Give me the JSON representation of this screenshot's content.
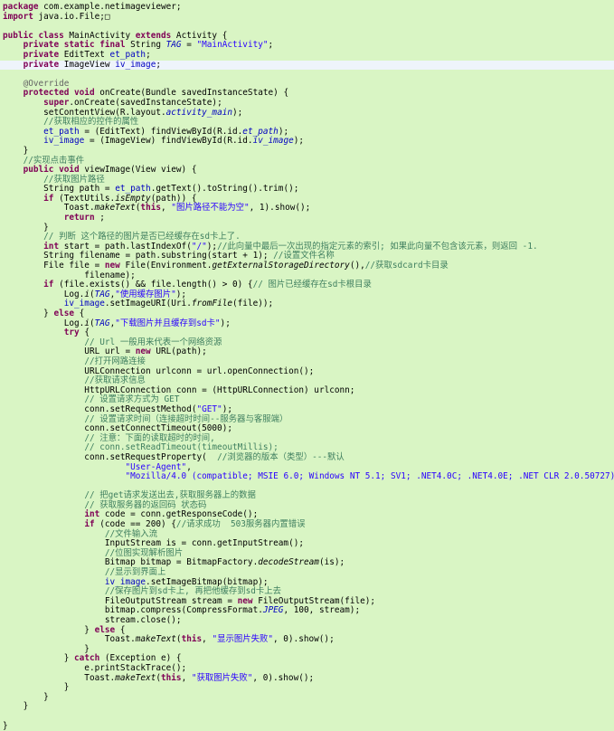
{
  "editor": {
    "lines": [
      [
        [
          "k",
          "package"
        ],
        [
          "p",
          " com.example.netimageviewer;"
        ]
      ],
      [
        [
          "k",
          "import"
        ],
        [
          "p",
          " java.io.File;□"
        ]
      ],
      [
        [
          "p",
          ""
        ]
      ],
      [
        [
          "k",
          "public class"
        ],
        [
          "p",
          " MainActivity "
        ],
        [
          "k",
          "extends"
        ],
        [
          "p",
          " Activity {"
        ]
      ],
      [
        [
          "p",
          "    "
        ],
        [
          "k",
          "private static final"
        ],
        [
          "p",
          " String "
        ],
        [
          "fi",
          "TAG"
        ],
        [
          "p",
          " = "
        ],
        [
          "s",
          "\"MainActivity\""
        ],
        [
          "p",
          ";"
        ]
      ],
      [
        [
          "p",
          "    "
        ],
        [
          "k",
          "private"
        ],
        [
          "p",
          " EditText "
        ],
        [
          "f",
          "et_path"
        ],
        [
          "p",
          ";"
        ]
      ],
      [
        [
          "p",
          "    "
        ],
        [
          "k",
          "private"
        ],
        [
          "p",
          " ImageView "
        ],
        [
          "f",
          "iv_image"
        ],
        [
          "p",
          ";"
        ]
      ],
      [
        [
          "p",
          ""
        ]
      ],
      [
        [
          "p",
          "    "
        ],
        [
          "a",
          "@Override"
        ]
      ],
      [
        [
          "p",
          "    "
        ],
        [
          "k",
          "protected void"
        ],
        [
          "p",
          " onCreate(Bundle savedInstanceState) {"
        ]
      ],
      [
        [
          "p",
          "        "
        ],
        [
          "k",
          "super"
        ],
        [
          "p",
          ".onCreate(savedInstanceState);"
        ]
      ],
      [
        [
          "p",
          "        setContentView(R.layout."
        ],
        [
          "fi",
          "activity_main"
        ],
        [
          "p",
          ");"
        ]
      ],
      [
        [
          "p",
          "        "
        ],
        [
          "c",
          "//获取相应的控件的属性"
        ]
      ],
      [
        [
          "p",
          "        "
        ],
        [
          "f",
          "et_path"
        ],
        [
          "p",
          " = (EditText) findViewById(R.id."
        ],
        [
          "fi",
          "et_path"
        ],
        [
          "p",
          ");"
        ]
      ],
      [
        [
          "p",
          "        "
        ],
        [
          "f",
          "iv_image"
        ],
        [
          "p",
          " = (ImageView) findViewById(R.id."
        ],
        [
          "fi",
          "iv_image"
        ],
        [
          "p",
          ");"
        ]
      ],
      [
        [
          "p",
          "    }"
        ]
      ],
      [
        [
          "p",
          "    "
        ],
        [
          "c",
          "//实现点击事件"
        ]
      ],
      [
        [
          "p",
          "    "
        ],
        [
          "k",
          "public void"
        ],
        [
          "p",
          " viewImage(View view) {"
        ]
      ],
      [
        [
          "p",
          "        "
        ],
        [
          "c",
          "//获取图片路径"
        ]
      ],
      [
        [
          "p",
          "        String path = "
        ],
        [
          "f",
          "et_path"
        ],
        [
          "p",
          ".getText().toString().trim();"
        ]
      ],
      [
        [
          "p",
          "        "
        ],
        [
          "k",
          "if"
        ],
        [
          "p",
          " (TextUtils."
        ],
        [
          "i",
          "isEmpty"
        ],
        [
          "p",
          "(path)) {"
        ]
      ],
      [
        [
          "p",
          "            Toast."
        ],
        [
          "i",
          "makeText"
        ],
        [
          "p",
          "("
        ],
        [
          "k",
          "this"
        ],
        [
          "p",
          ", "
        ],
        [
          "s",
          "\"图片路径不能为空\""
        ],
        [
          "p",
          ", 1).show();"
        ]
      ],
      [
        [
          "p",
          "            "
        ],
        [
          "k",
          "return"
        ],
        [
          "p",
          " ;"
        ]
      ],
      [
        [
          "p",
          "        }"
        ]
      ],
      [
        [
          "p",
          "        "
        ],
        [
          "c",
          "// 判断 这个路径的图片是否已经缓存在sd卡上了."
        ]
      ],
      [
        [
          "p",
          "        "
        ],
        [
          "k",
          "int"
        ],
        [
          "p",
          " start = path.lastIndexOf("
        ],
        [
          "s",
          "\"/\""
        ],
        [
          "p",
          ");"
        ],
        [
          "c",
          "//此向量中最后一次出现的指定元素的索引; 如果此向量不包含该元素，则返回 -1."
        ]
      ],
      [
        [
          "p",
          "        String filename = path.substring(start + 1); "
        ],
        [
          "c",
          "//设置文件名称"
        ]
      ],
      [
        [
          "p",
          "        File file = "
        ],
        [
          "k",
          "new"
        ],
        [
          "p",
          " File(Environment."
        ],
        [
          "i",
          "getExternalStorageDirectory"
        ],
        [
          "p",
          "(),"
        ],
        [
          "c",
          "//获取sdcard卡目录"
        ]
      ],
      [
        [
          "p",
          "                filename);"
        ]
      ],
      [
        [
          "p",
          "        "
        ],
        [
          "k",
          "if"
        ],
        [
          "p",
          " (file.exists() && file.length() > 0) {"
        ],
        [
          "c",
          "// 图片已经缓存在sd卡根目录"
        ]
      ],
      [
        [
          "p",
          "            Log."
        ],
        [
          "i",
          "i"
        ],
        [
          "p",
          "("
        ],
        [
          "fi",
          "TAG"
        ],
        [
          "p",
          ","
        ],
        [
          "s",
          "\"使用缓存图片\""
        ],
        [
          "p",
          ");"
        ]
      ],
      [
        [
          "p",
          "            "
        ],
        [
          "f",
          "iv_image"
        ],
        [
          "p",
          ".setImageURI(Uri."
        ],
        [
          "i",
          "fromFile"
        ],
        [
          "p",
          "(file));"
        ]
      ],
      [
        [
          "p",
          "        } "
        ],
        [
          "k",
          "else"
        ],
        [
          "p",
          " {"
        ]
      ],
      [
        [
          "p",
          "            Log."
        ],
        [
          "i",
          "i"
        ],
        [
          "p",
          "("
        ],
        [
          "fi",
          "TAG"
        ],
        [
          "p",
          ","
        ],
        [
          "s",
          "\"下载图片并且缓存到sd卡\""
        ],
        [
          "p",
          ");"
        ]
      ],
      [
        [
          "p",
          "            "
        ],
        [
          "k",
          "try"
        ],
        [
          "p",
          " {"
        ]
      ],
      [
        [
          "p",
          "                "
        ],
        [
          "c",
          "// Url 一般用来代表一个网络资源"
        ]
      ],
      [
        [
          "p",
          "                URL url = "
        ],
        [
          "k",
          "new"
        ],
        [
          "p",
          " URL(path);"
        ]
      ],
      [
        [
          "p",
          "                "
        ],
        [
          "c",
          "//打开网路连接"
        ]
      ],
      [
        [
          "p",
          "                URLConnection urlconn = url.openConnection();"
        ]
      ],
      [
        [
          "p",
          "                "
        ],
        [
          "c",
          "//获取请求信息"
        ]
      ],
      [
        [
          "p",
          "                HttpURLConnection conn = (HttpURLConnection) urlconn;"
        ]
      ],
      [
        [
          "p",
          "                "
        ],
        [
          "c",
          "// 设置请求方式为 GET"
        ]
      ],
      [
        [
          "p",
          "                conn.setRequestMethod("
        ],
        [
          "s",
          "\"GET\""
        ],
        [
          "p",
          ");"
        ]
      ],
      [
        [
          "p",
          "                "
        ],
        [
          "c",
          "// 设置请求时间（连接超时时间--服务器与客服端）"
        ]
      ],
      [
        [
          "p",
          "                conn.setConnectTimeout(5000);"
        ]
      ],
      [
        [
          "p",
          "                "
        ],
        [
          "c",
          "// 注意：下面的读取超时的时间,"
        ]
      ],
      [
        [
          "p",
          "                "
        ],
        [
          "c",
          "// conn.setReadTimeout(timeoutMillis);"
        ]
      ],
      [
        [
          "p",
          "                conn.setRequestProperty(  "
        ],
        [
          "c",
          "//浏览器的版本（类型）---默认"
        ]
      ],
      [
        [
          "p",
          "                        "
        ],
        [
          "s",
          "\"User-Agent\""
        ],
        [
          "p",
          ","
        ]
      ],
      [
        [
          "p",
          "                        "
        ],
        [
          "s",
          "\"Mozilla/4.0 (compatible; MSIE 6.0; Windows NT 5.1; SV1; .NET4.0C; .NET4.0E; .NET CLR 2.0.50727)\""
        ],
        [
          "p",
          ");"
        ]
      ],
      [
        [
          "p",
          ""
        ]
      ],
      [
        [
          "p",
          "                "
        ],
        [
          "c",
          "// 把get请求发送出去,获取服务器上的数据"
        ]
      ],
      [
        [
          "p",
          "                "
        ],
        [
          "c",
          "// 获取服务器的返回码 状态码"
        ]
      ],
      [
        [
          "p",
          "                "
        ],
        [
          "k",
          "int"
        ],
        [
          "p",
          " code = conn.getResponseCode();"
        ]
      ],
      [
        [
          "p",
          "                "
        ],
        [
          "k",
          "if"
        ],
        [
          "p",
          " (code == 200) {"
        ],
        [
          "c",
          "//请求成功  503服务器内置错误"
        ]
      ],
      [
        [
          "p",
          "                    "
        ],
        [
          "c",
          "//文件输入流"
        ]
      ],
      [
        [
          "p",
          "                    InputStream is = conn.getInputStream();"
        ]
      ],
      [
        [
          "p",
          "                    "
        ],
        [
          "c",
          "//位图实现解析图片"
        ]
      ],
      [
        [
          "p",
          "                    Bitmap bitmap = BitmapFactory."
        ],
        [
          "i",
          "decodeStream"
        ],
        [
          "p",
          "(is);"
        ]
      ],
      [
        [
          "p",
          "                    "
        ],
        [
          "c",
          "//显示到界面上"
        ]
      ],
      [
        [
          "p",
          "                    "
        ],
        [
          "f",
          "iv_image"
        ],
        [
          "p",
          ".setImageBitmap(bitmap);"
        ]
      ],
      [
        [
          "p",
          "                    "
        ],
        [
          "c",
          "//保存图片到sd卡上, 再把他缓存到sd卡上去"
        ]
      ],
      [
        [
          "p",
          "                    FileOutputStream stream = "
        ],
        [
          "k",
          "new"
        ],
        [
          "p",
          " FileOutputStream(file);"
        ]
      ],
      [
        [
          "p",
          "                    bitmap.compress(CompressFormat."
        ],
        [
          "fi",
          "JPEG"
        ],
        [
          "p",
          ", 100, stream);"
        ]
      ],
      [
        [
          "p",
          "                    stream.close();"
        ]
      ],
      [
        [
          "p",
          "                } "
        ],
        [
          "k",
          "else"
        ],
        [
          "p",
          " {"
        ]
      ],
      [
        [
          "p",
          "                    Toast."
        ],
        [
          "i",
          "makeText"
        ],
        [
          "p",
          "("
        ],
        [
          "k",
          "this"
        ],
        [
          "p",
          ", "
        ],
        [
          "s",
          "\"显示图片失败\""
        ],
        [
          "p",
          ", 0).show();"
        ]
      ],
      [
        [
          "p",
          "                }"
        ]
      ],
      [
        [
          "p",
          "            } "
        ],
        [
          "k",
          "catch"
        ],
        [
          "p",
          " (Exception e) {"
        ]
      ],
      [
        [
          "p",
          "                e.printStackTrace();"
        ]
      ],
      [
        [
          "p",
          "                Toast."
        ],
        [
          "i",
          "makeText"
        ],
        [
          "p",
          "("
        ],
        [
          "k",
          "this"
        ],
        [
          "p",
          ", "
        ],
        [
          "s",
          "\"获取图片失败\""
        ],
        [
          "p",
          ", 0).show();"
        ]
      ],
      [
        [
          "p",
          "            }"
        ]
      ],
      [
        [
          "p",
          "        }"
        ]
      ],
      [
        [
          "p",
          "    }"
        ]
      ],
      [
        [
          "p",
          ""
        ]
      ],
      [
        [
          "p",
          "}"
        ]
      ]
    ],
    "highlighted_line": 6
  }
}
